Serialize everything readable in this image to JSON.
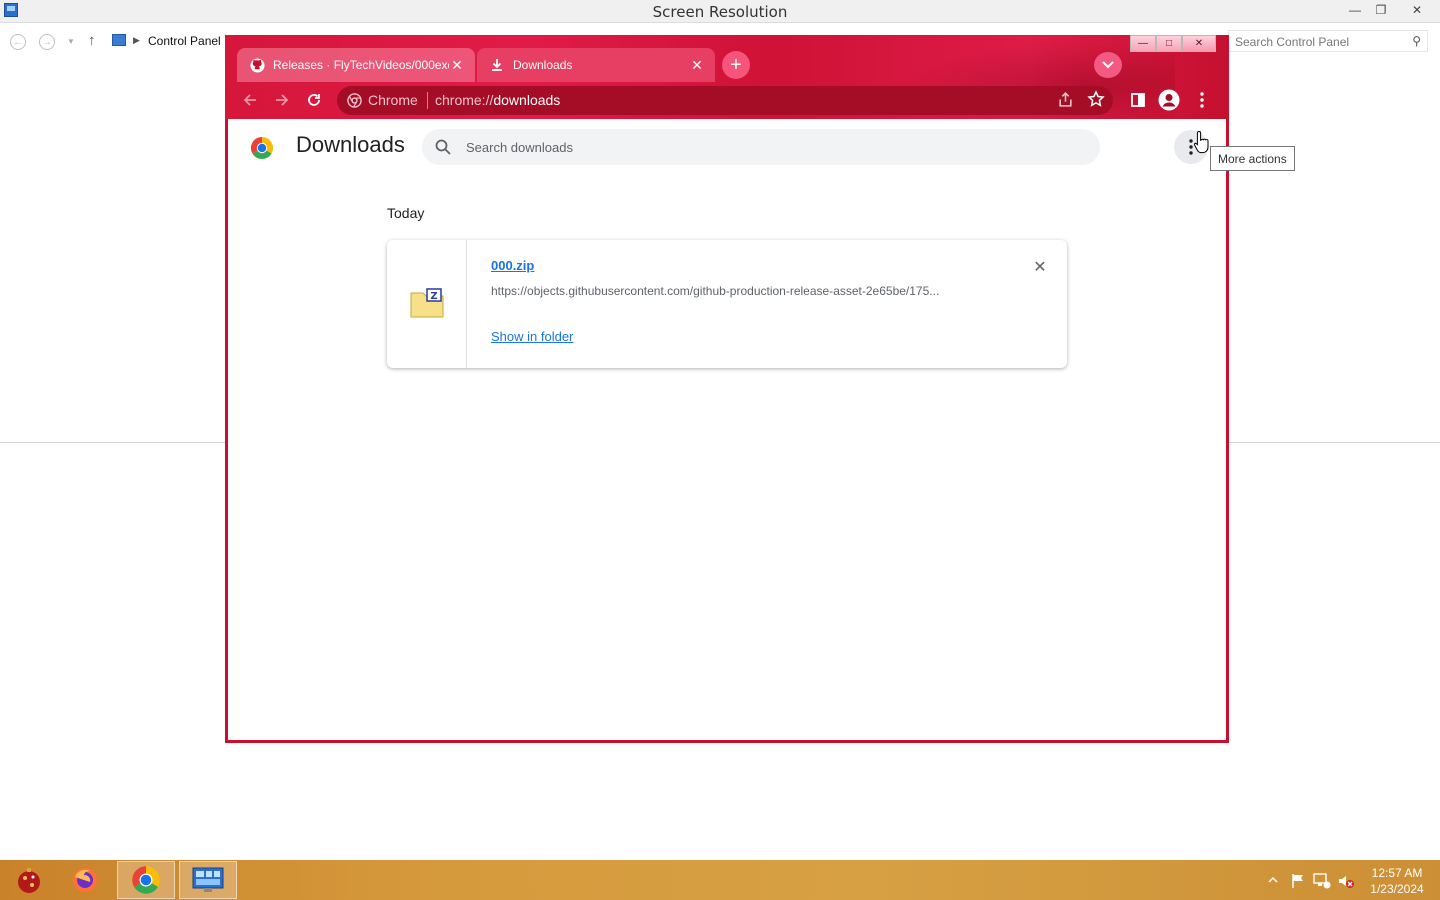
{
  "control_panel": {
    "window_title": "Screen Resolution",
    "breadcrumb": "Control Panel",
    "search_placeholder": "Search Control Panel"
  },
  "browser": {
    "tabs": [
      {
        "label": "Releases · FlyTechVideos/000exe",
        "icon": "github-icon",
        "active": false
      },
      {
        "label": "Downloads",
        "icon": "download-icon",
        "active": true
      }
    ],
    "omnibox": {
      "chip": "Chrome",
      "url_prefix": "chrome://",
      "url_host": "downloads"
    },
    "theme_color": "#d5173a"
  },
  "downloads_page": {
    "title": "Downloads",
    "search_placeholder": "Search downloads",
    "more_actions_tooltip": "More actions",
    "section_label": "Today",
    "items": [
      {
        "filename": "000.zip",
        "url": "https://objects.githubusercontent.com/github-production-release-asset-2e65be/175...",
        "action": "Show in folder"
      }
    ]
  },
  "taskbar": {
    "apps": [
      "ornament-icon",
      "firefox-icon",
      "chrome-icon",
      "control-panel-icon"
    ],
    "clock_time": "12:57 AM",
    "clock_date": "1/23/2024"
  }
}
